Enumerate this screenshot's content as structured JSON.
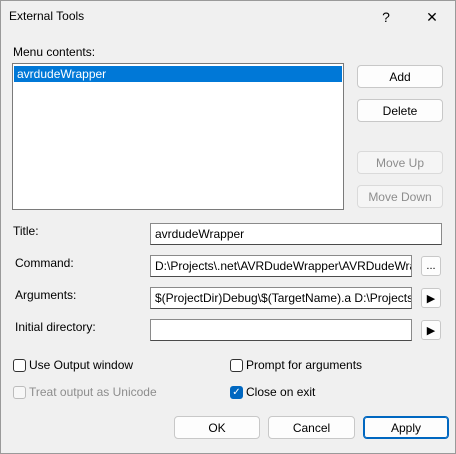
{
  "window": {
    "title": "External Tools",
    "help_glyph": "?",
    "close_glyph": "✕"
  },
  "menu": {
    "label": "Menu contents:",
    "items": [
      "avrdudeWrapper"
    ]
  },
  "buttons": {
    "add": "Add",
    "delete": "Delete",
    "move_up": "Move Up",
    "move_down": "Move Down",
    "ok": "OK",
    "cancel": "Cancel",
    "apply": "Apply"
  },
  "fields": {
    "title_label": "Title:",
    "title_value": "avrdudeWrapper",
    "command_label": "Command:",
    "command_value": "D:\\Projects\\.net\\AVRDudeWrapper\\AVRDudeWra",
    "command_browse": "...",
    "arguments_label": "Arguments:",
    "arguments_value": "$(ProjectDir)Debug\\$(TargetName).a D:\\Projects",
    "arguments_arrow": "▶",
    "initial_dir_label": "Initial directory:",
    "initial_dir_value": "",
    "initial_dir_arrow": "▶"
  },
  "options": {
    "use_output_window": {
      "label": "Use Output window",
      "checked": false
    },
    "prompt_for_arguments": {
      "label": "Prompt for arguments",
      "checked": false
    },
    "treat_output_unicode": {
      "label": "Treat output as Unicode",
      "checked": false,
      "disabled": true
    },
    "close_on_exit": {
      "label": "Close on exit",
      "checked": true
    }
  },
  "colors": {
    "selection": "#0078d7",
    "accent": "#0067c0"
  }
}
